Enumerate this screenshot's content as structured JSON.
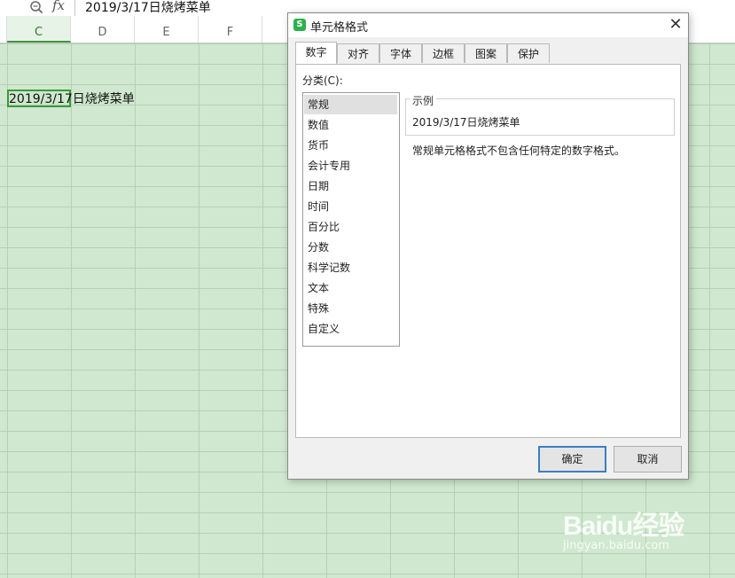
{
  "formula_bar": {
    "fx": "fx",
    "value": "2019/3/17日烧烤菜单",
    "zoom_icon": "zoom-icon"
  },
  "columns": [
    {
      "label": "C",
      "selected": true
    },
    {
      "label": "D"
    },
    {
      "label": "E"
    },
    {
      "label": "F"
    }
  ],
  "cell": {
    "text": "2019/3/17日烧烤菜单"
  },
  "dialog": {
    "title": "单元格格式",
    "tabs": [
      "数字",
      "对齐",
      "字体",
      "边框",
      "图案",
      "保护"
    ],
    "active_tab": "数字",
    "category_label": "分类(C):",
    "categories": [
      "常规",
      "数值",
      "货币",
      "会计专用",
      "日期",
      "时间",
      "百分比",
      "分数",
      "科学记数",
      "文本",
      "特殊",
      "自定义"
    ],
    "selected_category": "常规",
    "sample_legend": "示例",
    "sample_value": "2019/3/17日烧烤菜单",
    "description": "常规单元格格式不包含任何特定的数字格式。",
    "ok_label": "确定",
    "cancel_label": "取消"
  },
  "watermark": {
    "brand": "Baidu经验",
    "url": "jingyan.baidu.com"
  },
  "colors": {
    "sheet_bg": "#cfe8cf",
    "selection": "#3a9a3a",
    "primary_button_border": "#3b7fc4"
  }
}
